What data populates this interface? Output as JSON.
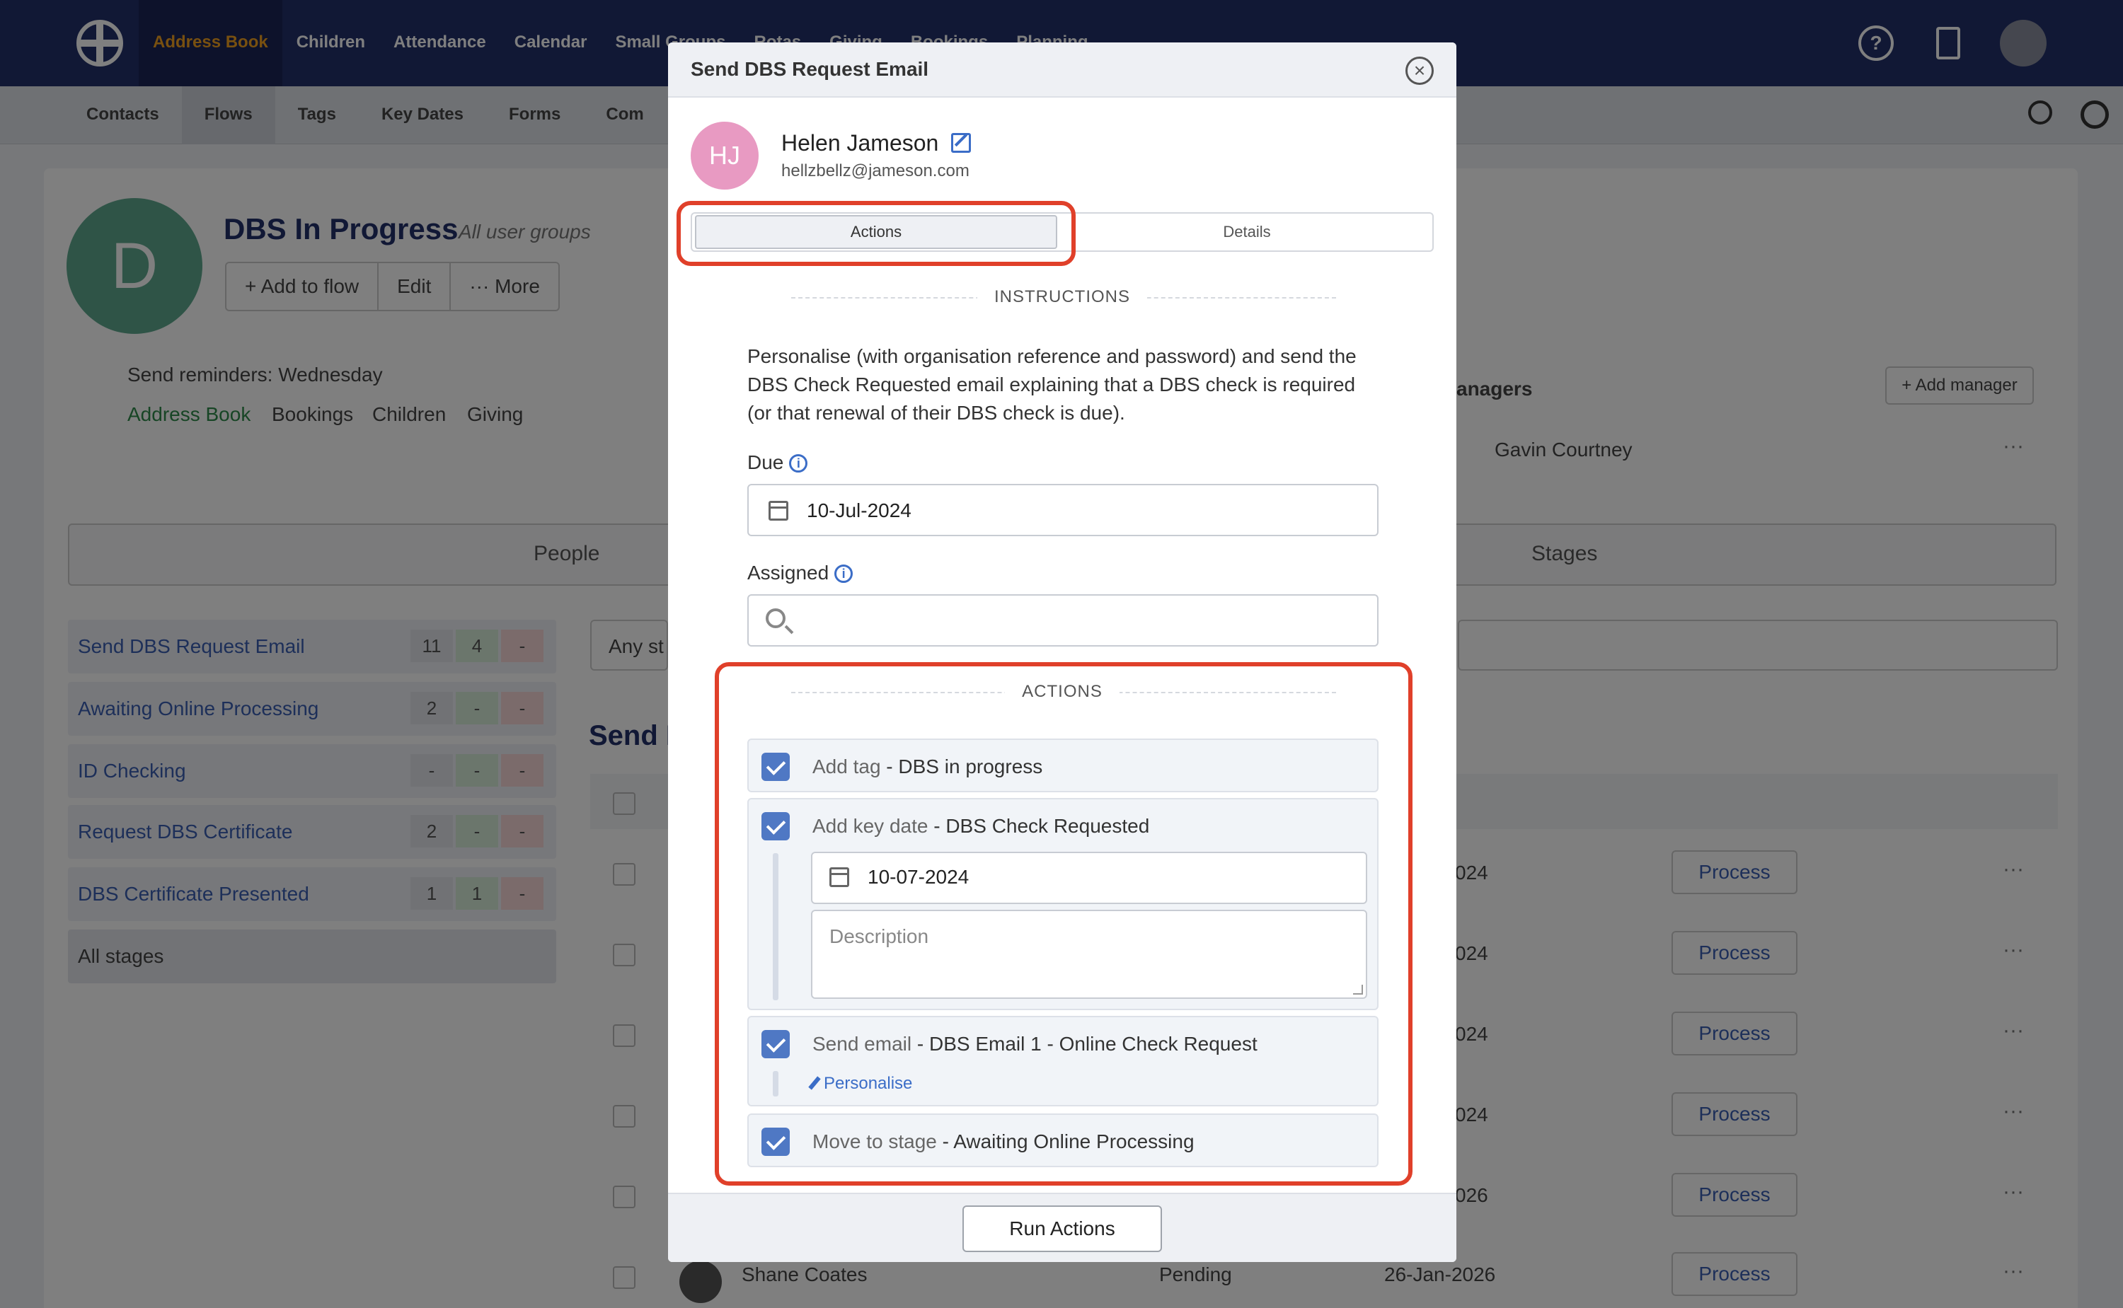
{
  "topnav": {
    "items": [
      "Address Book",
      "Children",
      "Attendance",
      "Calendar",
      "Small Groups",
      "Rotas",
      "Giving",
      "Bookings",
      "Planning"
    ],
    "active": "Address Book",
    "help_glyph": "?"
  },
  "subnav": {
    "items": [
      "Contacts",
      "Flows",
      "Tags",
      "Key Dates",
      "Forms",
      "Com"
    ],
    "active": "Flows"
  },
  "background": {
    "avatar_letter": "D",
    "title": "DBS In Progress",
    "subtitle": "All user groups",
    "buttons": [
      "+ Add to flow",
      "Edit",
      "··· More"
    ],
    "reminder": "Send reminders: Wednesday",
    "visibility": [
      "Address Book",
      "Bookings",
      "Children",
      "Giving"
    ],
    "managers_title": "anagers",
    "add_manager": "+ Add manager",
    "manager_name": "Gavin Courtney",
    "tab_people": "People",
    "tab_stages": "Stages",
    "stages": [
      {
        "name": "Send DBS Request Email",
        "a": "11",
        "b": "4",
        "c": "-"
      },
      {
        "name": "Awaiting Online Processing",
        "a": "2",
        "b": "-",
        "c": "-"
      },
      {
        "name": "ID Checking",
        "a": "-",
        "b": "-",
        "c": "-"
      },
      {
        "name": "Request DBS Certificate",
        "a": "2",
        "b": "-",
        "c": "-"
      },
      {
        "name": "DBS Certificate Presented",
        "a": "1",
        "b": "1",
        "c": "-"
      }
    ],
    "all_stages": "All stages",
    "filter": "Any st",
    "section_title": "Send I",
    "rows": [
      {
        "date": "024",
        "process": "Process"
      },
      {
        "date": "024",
        "process": "Process"
      },
      {
        "date": "024",
        "process": "Process"
      },
      {
        "date": "024",
        "process": "Process"
      },
      {
        "date": "026",
        "process": "Process"
      }
    ],
    "last_row": {
      "name": "Shane Coates",
      "status": "Pending",
      "date": "26-Jan-2026",
      "process": "Process"
    }
  },
  "modal": {
    "title": "Send DBS Request Email",
    "close_glyph": "×",
    "person": {
      "initials": "HJ",
      "name": "Helen Jameson",
      "email": "hellzbellz@jameson.com"
    },
    "tabs": {
      "actions": "Actions",
      "details": "Details"
    },
    "instructions_heading": "INSTRUCTIONS",
    "instructions_text": "Personalise (with organisation reference and password) and send the DBS Check Requested email explaining that a DBS check is required (or that renewal of their DBS check is due).",
    "due_label": "Due",
    "due_value": "10-Jul-2024",
    "assigned_label": "Assigned",
    "actions_heading": "ACTIONS",
    "actions": {
      "tag_prefix": "Add tag",
      "tag_value": " - DBS in progress",
      "keydate_prefix": "Add key date",
      "keydate_value": " - DBS Check Requested",
      "keydate_date": "10-07-2024",
      "description_placeholder": "Description",
      "email_prefix": "Send email",
      "email_value": " - DBS Email 1 - Online Check Request",
      "personalise": "Personalise",
      "stage_prefix": "Move to stage",
      "stage_value": " - Awaiting Online Processing"
    },
    "run_button": "Run Actions",
    "info_glyph": "i"
  },
  "colors": {
    "nav": "#23306b",
    "highlight": "#e0402a",
    "checkbox": "#4f78c4",
    "link": "#3b6dc7",
    "avatar": "#e89ac2"
  }
}
